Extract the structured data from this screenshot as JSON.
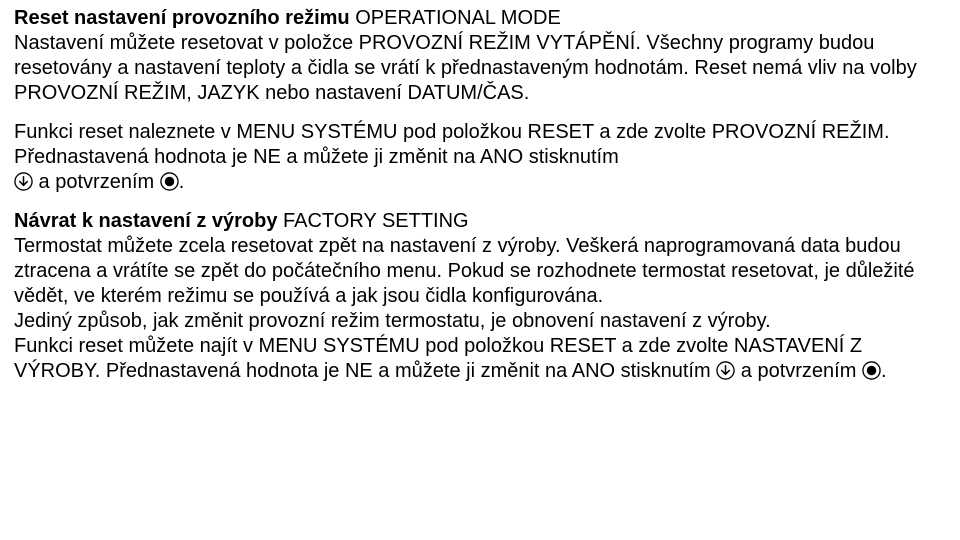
{
  "sec1": {
    "heading_bold": "Reset nastavení provozního režimu ",
    "heading_rest": "OPERATIONAL MODE",
    "body": "Nastavení můžete resetovat v položce PROVOZNÍ REŽIM VYTÁPĚNÍ. Všechny programy budou resetovány a nastavení teploty a čidla se vrátí k přednastaveným hodnotám. Reset nemá vliv na volby PROVOZNÍ REŽIM, JAZYK nebo nastavení DATUM/ČAS."
  },
  "sec2": {
    "line1": "Funkci reset naleznete v MENU SYSTÉMU pod položkou RESET a zde zvolte PROVOZNÍ REŽIM. Přednastavená hodnota je NE a můžete ji změnit na ANO stisknutím",
    "line2a": " a potvrzením ",
    "line2b": "."
  },
  "sec3": {
    "heading_bold": "Návrat k nastavení z výroby ",
    "heading_rest": "FACTORY SETTING",
    "body1": "Termostat můžete zcela resetovat zpět na nastavení z výroby. Veškerá naprogramovaná data budou ztracena a vrátíte se zpět do počátečního menu. Pokud se rozhodnete termostat resetovat, je důležité vědět, ve kterém režimu se používá a jak jsou čidla konfigurována.",
    "body2": "Jediný způsob, jak změnit provozní režim termostatu, je obnovení nastavení z výroby.",
    "body3a": "Funkci reset můžete najít v MENU SYSTÉMU pod položkou RESET a zde zvolte NASTAVENÍ Z VÝROBY. Přednastavená hodnota je NE a můžete ji změnit na ANO stisknutím ",
    "body3b": " a potvrzením ",
    "body3c": "."
  },
  "icons": {
    "down": "down-arrow-in-circle-icon",
    "confirm": "filled-circle-icon"
  }
}
